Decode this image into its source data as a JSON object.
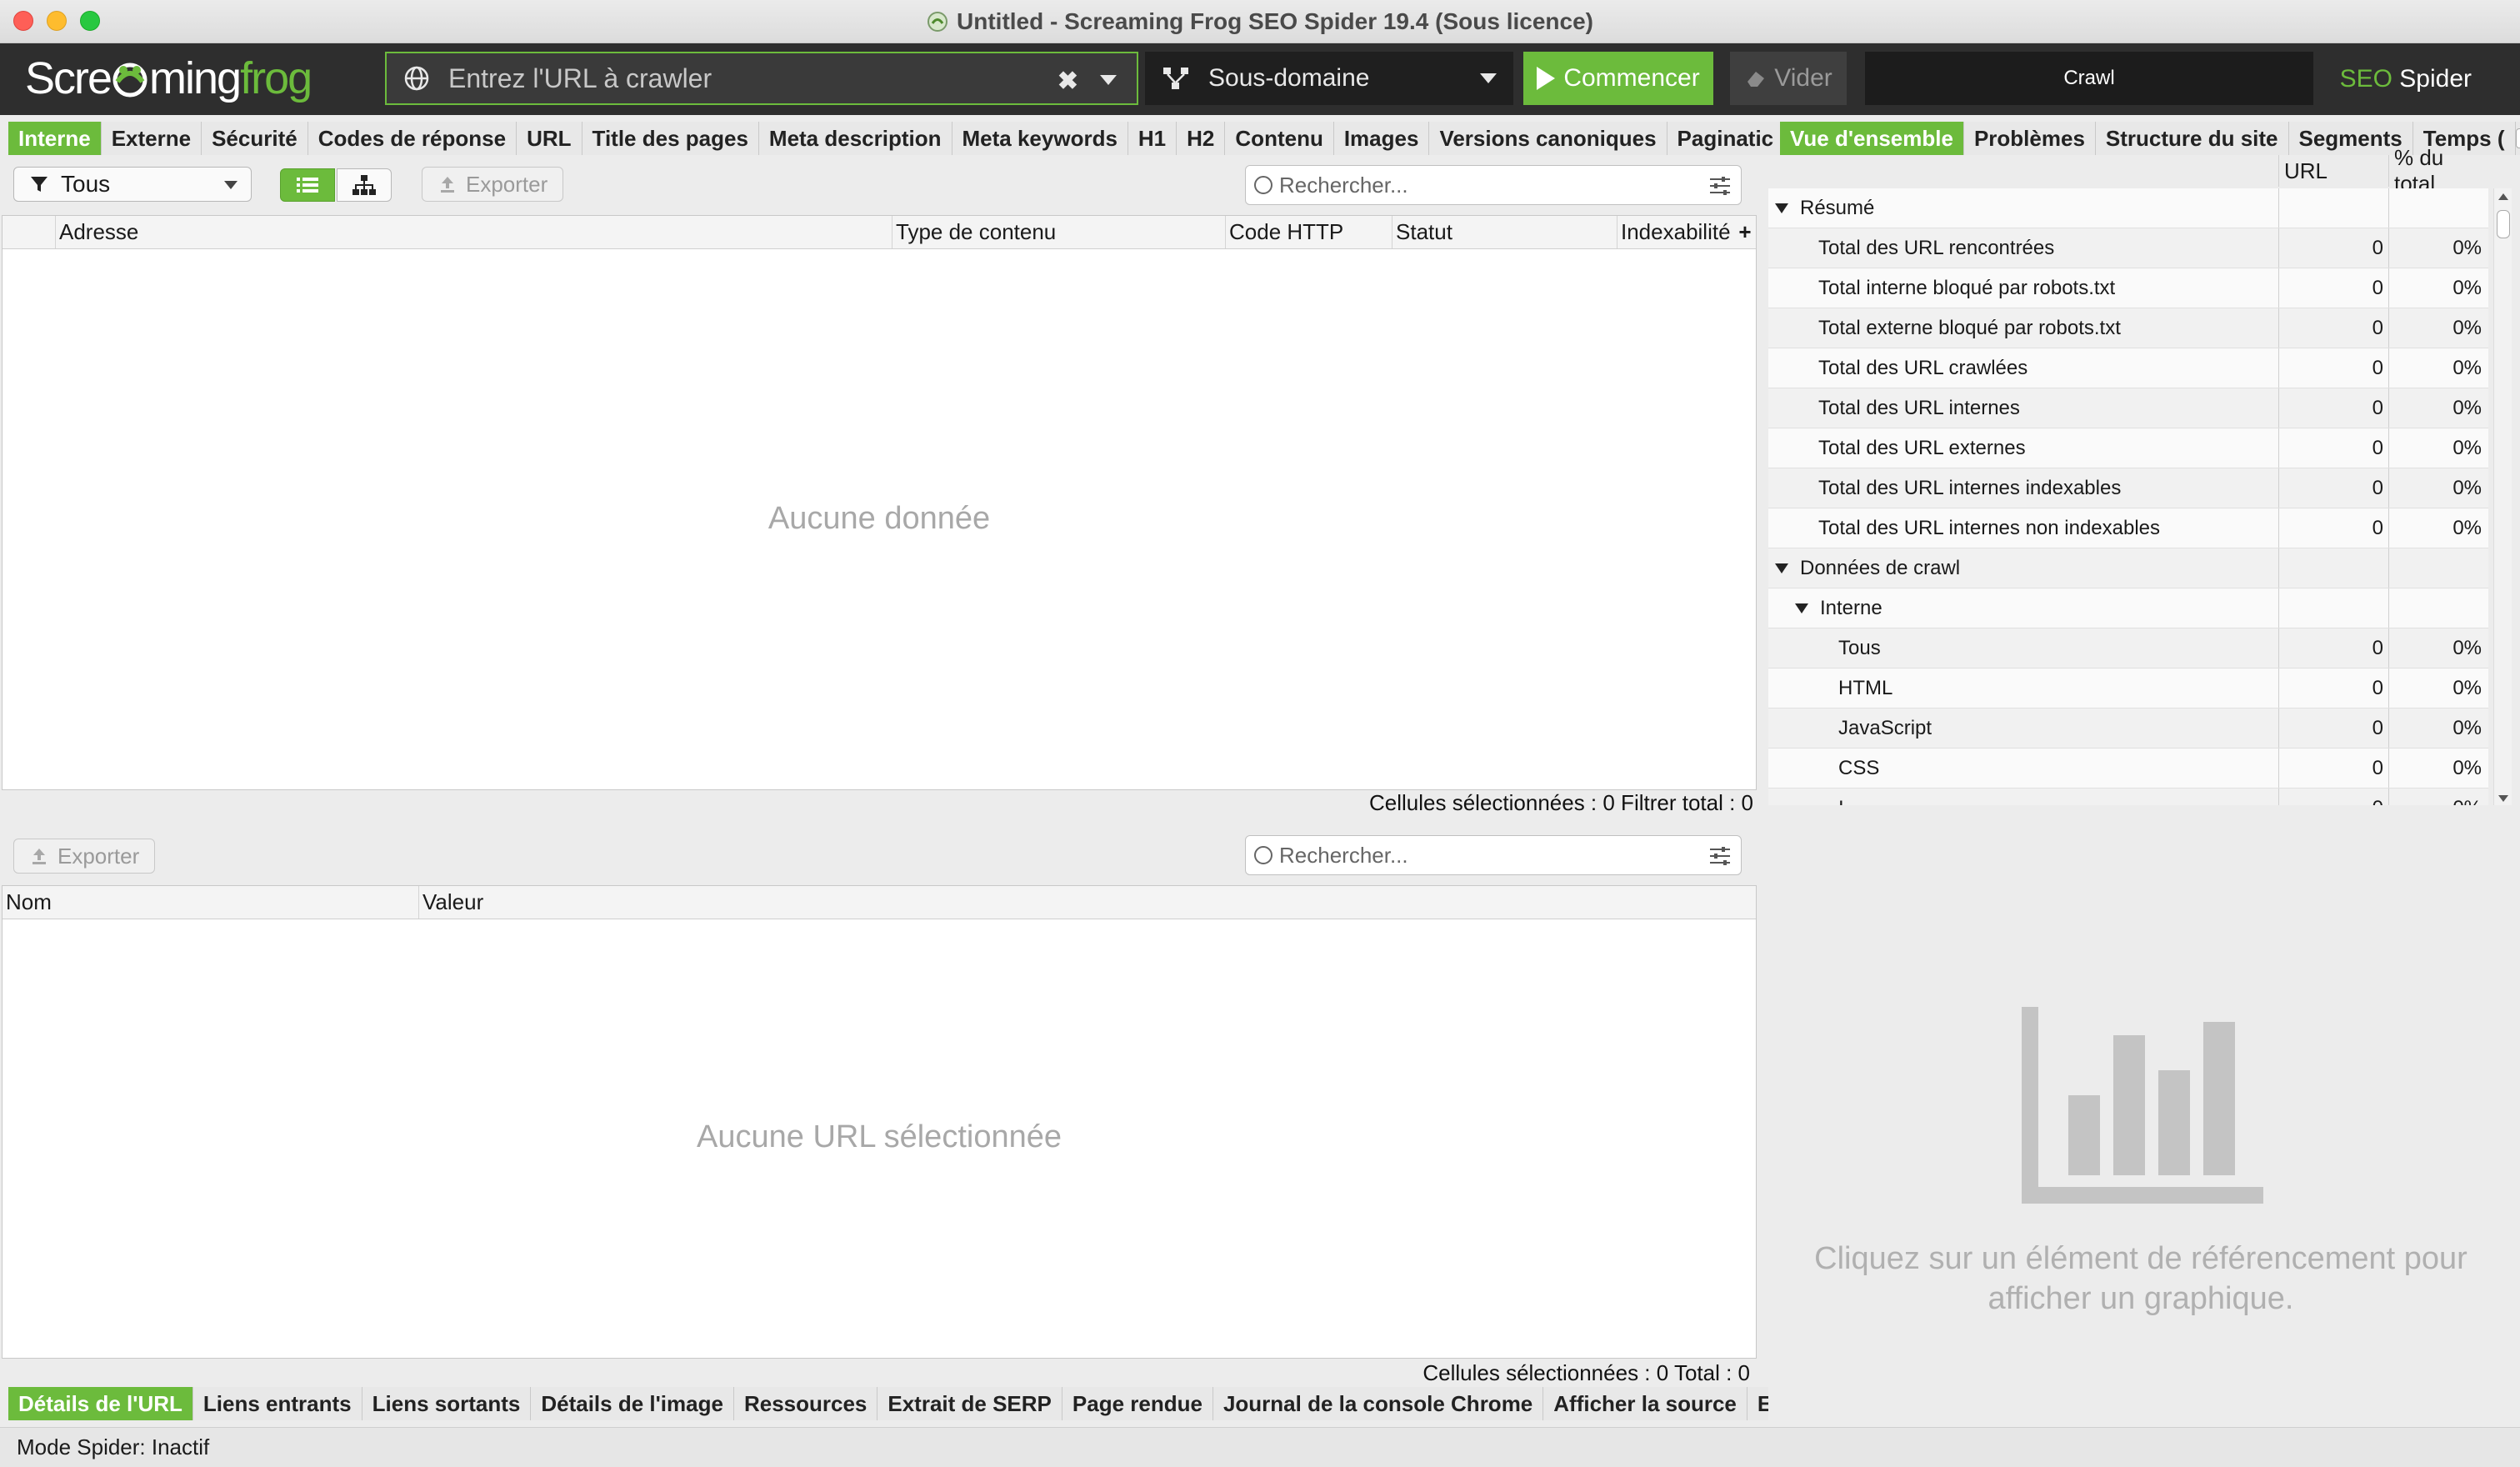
{
  "window": {
    "title": "Untitled - Screaming Frog SEO Spider 19.4 (Sous licence)"
  },
  "toolbar": {
    "logo_prefix": "Scre",
    "logo_frog_glyph": "a",
    "logo_middle": "ming",
    "logo_suffix": "frog",
    "url_placeholder": "Entrez l'URL à crawler",
    "mode_label": "Sous-domaine",
    "start_label": "Commencer",
    "clear_label": "Vider",
    "crawl_label": "Crawl",
    "brand_seo": "SEO",
    "brand_spider": " Spider",
    "accent_color": "#6cbb3c"
  },
  "left_tabs": [
    "Interne",
    "Externe",
    "Sécurité",
    "Codes de réponse",
    "URL",
    "Title des pages",
    "Meta description",
    "Meta keywords",
    "H1",
    "H2",
    "Contenu",
    "Images",
    "Versions canoniques",
    "Paginatic"
  ],
  "right_tabs": [
    "Vue d'ensemble",
    "Problèmes",
    "Structure du site",
    "Segments",
    "Temps ("
  ],
  "bottom_tabs": [
    "Détails de l'URL",
    "Liens entrants",
    "Liens sortants",
    "Détails de l'image",
    "Ressources",
    "Extrait de SERP",
    "Page rendue",
    "Journal de la console Chrome",
    "Afficher la source",
    "En-t"
  ],
  "top_table": {
    "filter_label": "Tous",
    "export_label": "Exporter",
    "search_placeholder": "Rechercher...",
    "columns": [
      "Adresse",
      "Type de contenu",
      "Code HTTP",
      "Statut",
      "Indexabilité"
    ],
    "empty_message": "Aucune donnée",
    "status_selected": "Cellules sélectionnées :  0  Filtrer total :  0"
  },
  "bottom_table": {
    "export_label": "Exporter",
    "search_placeholder": "Rechercher...",
    "columns": [
      "Nom",
      "Valeur"
    ],
    "empty_message": "Aucune URL sélectionnée",
    "status_selected": "Cellules sélectionnées :  0  Total :  0"
  },
  "overview": {
    "col_url": "URL",
    "col_pct": "% du total",
    "rows": [
      {
        "name": "Résumé",
        "level": 0,
        "group": true,
        "v1": "",
        "v2": ""
      },
      {
        "name": "Total des URL rencontrées",
        "level": 1,
        "group": false,
        "v1": "0",
        "v2": "0%"
      },
      {
        "name": "Total interne bloqué par robots.txt",
        "level": 1,
        "group": false,
        "v1": "0",
        "v2": "0%"
      },
      {
        "name": "Total externe bloqué par robots.txt",
        "level": 1,
        "group": false,
        "v1": "0",
        "v2": "0%"
      },
      {
        "name": "Total des URL crawlées",
        "level": 1,
        "group": false,
        "v1": "0",
        "v2": "0%"
      },
      {
        "name": "Total des URL internes",
        "level": 1,
        "group": false,
        "v1": "0",
        "v2": "0%"
      },
      {
        "name": "Total des URL externes",
        "level": 1,
        "group": false,
        "v1": "0",
        "v2": "0%"
      },
      {
        "name": "Total des URL internes indexables",
        "level": 1,
        "group": false,
        "v1": "0",
        "v2": "0%"
      },
      {
        "name": "Total des URL internes non indexables",
        "level": 1,
        "group": false,
        "v1": "0",
        "v2": "0%"
      },
      {
        "name": "Données de crawl",
        "level": 0,
        "group": true,
        "v1": "",
        "v2": ""
      },
      {
        "name": "Interne",
        "level": 1,
        "group": true,
        "v1": "",
        "v2": ""
      },
      {
        "name": "Tous",
        "level": 2,
        "group": false,
        "v1": "0",
        "v2": "0%"
      },
      {
        "name": "HTML",
        "level": 2,
        "group": false,
        "v1": "0",
        "v2": "0%"
      },
      {
        "name": "JavaScript",
        "level": 2,
        "group": false,
        "v1": "0",
        "v2": "0%"
      },
      {
        "name": "CSS",
        "level": 2,
        "group": false,
        "v1": "0",
        "v2": "0%"
      },
      {
        "name": "I",
        "level": 2,
        "group": false,
        "v1": "0",
        "v2": "0%"
      }
    ],
    "chart_message": "Cliquez sur un élément de référencement pour afficher un graphique."
  },
  "statusbar": {
    "text": "Mode Spider: Inactif"
  }
}
